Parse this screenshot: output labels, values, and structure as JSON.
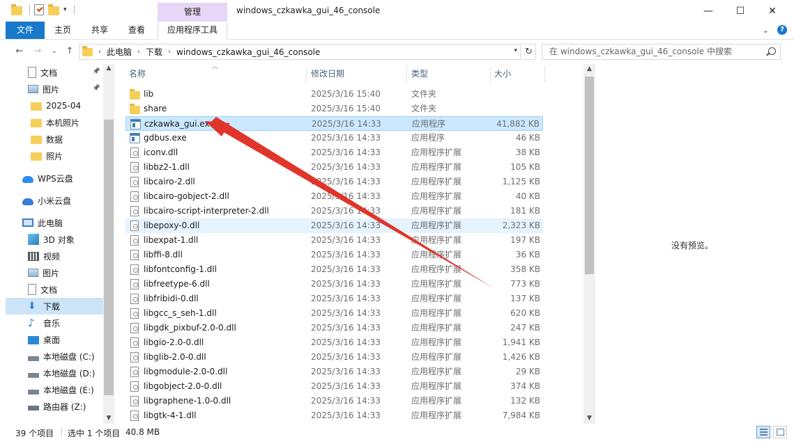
{
  "window": {
    "title": "windows_czkawka_gui_46_console",
    "manage_label": "管理",
    "controls": {
      "minimize": "—",
      "maximize": "☐",
      "close": "✕"
    }
  },
  "ribbon": {
    "file": "文件",
    "home": "主页",
    "share": "共享",
    "view": "查看",
    "app_tools": "应用程序工具",
    "expand": "⌄",
    "help": "?"
  },
  "nav": {
    "back": "←",
    "forward": "→",
    "recent": "⌄",
    "up": "↑",
    "breadcrumb": [
      "此电脑",
      "下载",
      "windows_czkawka_gui_46_console"
    ],
    "refresh": "↻",
    "search_placeholder": "在 windows_czkawka_gui_46_console 中搜索"
  },
  "sidebar": {
    "items": [
      {
        "label": "文档",
        "icon": "document-icon",
        "pinned": true
      },
      {
        "label": "图片",
        "icon": "pictures-icon",
        "pinned": true
      },
      {
        "label": "2025-04",
        "icon": "folder-icon"
      },
      {
        "label": "本机照片",
        "icon": "folder-icon"
      },
      {
        "label": "数据",
        "icon": "folder-icon"
      },
      {
        "label": "照片",
        "icon": "folder-icon"
      },
      {
        "label": "WPS云盘",
        "icon": "wps-cloud-icon"
      },
      {
        "label": "小米云盘",
        "icon": "mi-cloud-icon"
      },
      {
        "label": "此电脑",
        "icon": "computer-icon"
      },
      {
        "label": "3D 对象",
        "icon": "3d-objects-icon"
      },
      {
        "label": "视频",
        "icon": "video-icon"
      },
      {
        "label": "图片",
        "icon": "pictures-icon"
      },
      {
        "label": "文档",
        "icon": "document-icon"
      },
      {
        "label": "下载",
        "icon": "download-icon",
        "selected": true
      },
      {
        "label": "音乐",
        "icon": "music-icon"
      },
      {
        "label": "桌面",
        "icon": "desktop-icon"
      },
      {
        "label": "本地磁盘 (C:)",
        "icon": "drive-icon"
      },
      {
        "label": "本地磁盘 (D:)",
        "icon": "drive-icon"
      },
      {
        "label": "本地磁盘 (E:)",
        "icon": "drive-icon"
      },
      {
        "label": "路由器 (Z:)",
        "icon": "network-drive-icon"
      }
    ]
  },
  "columns": {
    "name": "名称",
    "date": "修改日期",
    "type": "类型",
    "size": "大小"
  },
  "files": [
    {
      "name": "lib",
      "date": "2025/3/16 15:40",
      "type": "文件夹",
      "size": "",
      "kind": "folder"
    },
    {
      "name": "share",
      "date": "2025/3/16 15:40",
      "type": "文件夹",
      "size": "",
      "kind": "folder"
    },
    {
      "name": "czkawka_gui.exe",
      "date": "2025/3/16 14:33",
      "type": "应用程序",
      "size": "41,882 KB",
      "kind": "exe",
      "selected": true
    },
    {
      "name": "gdbus.exe",
      "date": "2025/3/16 14:33",
      "type": "应用程序",
      "size": "46 KB",
      "kind": "exe"
    },
    {
      "name": "iconv.dll",
      "date": "2025/3/16 14:33",
      "type": "应用程序扩展",
      "size": "38 KB",
      "kind": "dll"
    },
    {
      "name": "libbz2-1.dll",
      "date": "2025/3/16 14:33",
      "type": "应用程序扩展",
      "size": "105 KB",
      "kind": "dll"
    },
    {
      "name": "libcairo-2.dll",
      "date": "2025/3/16 14:33",
      "type": "应用程序扩展",
      "size": "1,125 KB",
      "kind": "dll"
    },
    {
      "name": "libcairo-gobject-2.dll",
      "date": "2025/3/16 14:33",
      "type": "应用程序扩展",
      "size": "40 KB",
      "kind": "dll"
    },
    {
      "name": "libcairo-script-interpreter-2.dll",
      "date": "2025/3/16 14:33",
      "type": "应用程序扩展",
      "size": "181 KB",
      "kind": "dll"
    },
    {
      "name": "libepoxy-0.dll",
      "date": "2025/3/16 14:33",
      "type": "应用程序扩展",
      "size": "2,323 KB",
      "kind": "dll",
      "hover": true
    },
    {
      "name": "libexpat-1.dll",
      "date": "2025/3/16 14:33",
      "type": "应用程序扩展",
      "size": "197 KB",
      "kind": "dll"
    },
    {
      "name": "libffi-8.dll",
      "date": "2025/3/16 14:33",
      "type": "应用程序扩展",
      "size": "36 KB",
      "kind": "dll"
    },
    {
      "name": "libfontconfig-1.dll",
      "date": "2025/3/16 14:33",
      "type": "应用程序扩展",
      "size": "358 KB",
      "kind": "dll"
    },
    {
      "name": "libfreetype-6.dll",
      "date": "2025/3/16 14:33",
      "type": "应用程序扩展",
      "size": "773 KB",
      "kind": "dll"
    },
    {
      "name": "libfribidi-0.dll",
      "date": "2025/3/16 14:33",
      "type": "应用程序扩展",
      "size": "137 KB",
      "kind": "dll"
    },
    {
      "name": "libgcc_s_seh-1.dll",
      "date": "2025/3/16 14:33",
      "type": "应用程序扩展",
      "size": "620 KB",
      "kind": "dll"
    },
    {
      "name": "libgdk_pixbuf-2.0-0.dll",
      "date": "2025/3/16 14:33",
      "type": "应用程序扩展",
      "size": "247 KB",
      "kind": "dll"
    },
    {
      "name": "libgio-2.0-0.dll",
      "date": "2025/3/16 14:33",
      "type": "应用程序扩展",
      "size": "1,941 KB",
      "kind": "dll"
    },
    {
      "name": "libglib-2.0-0.dll",
      "date": "2025/3/16 14:33",
      "type": "应用程序扩展",
      "size": "1,426 KB",
      "kind": "dll"
    },
    {
      "name": "libgmodule-2.0-0.dll",
      "date": "2025/3/16 14:33",
      "type": "应用程序扩展",
      "size": "29 KB",
      "kind": "dll"
    },
    {
      "name": "libgobject-2.0-0.dll",
      "date": "2025/3/16 14:33",
      "type": "应用程序扩展",
      "size": "374 KB",
      "kind": "dll"
    },
    {
      "name": "libgraphene-1.0-0.dll",
      "date": "2025/3/16 14:33",
      "type": "应用程序扩展",
      "size": "132 KB",
      "kind": "dll"
    },
    {
      "name": "libgtk-4-1.dll",
      "date": "2025/3/16 14:33",
      "type": "应用程序扩展",
      "size": "7,984 KB",
      "kind": "dll"
    }
  ],
  "preview": {
    "empty_text": "没有预览。"
  },
  "status": {
    "count": "39 个项目",
    "selected": "选中 1 个项目",
    "size": "40.8 MB"
  },
  "colors": {
    "accent": "#1979ca",
    "selection": "#cce8ff",
    "manage_tab": "#e7d6f5",
    "annotation_arrow": "#e0352b"
  }
}
